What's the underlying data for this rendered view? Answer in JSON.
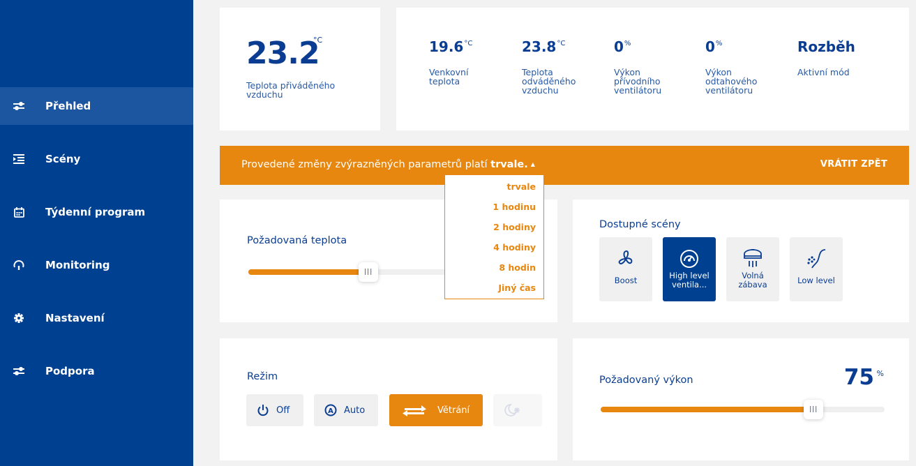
{
  "sidebar": {
    "items": [
      {
        "label": "Přehled",
        "icon": "sliders-icon",
        "active": true
      },
      {
        "label": "Scény",
        "icon": "list-indent-icon"
      },
      {
        "label": "Týdenní program",
        "icon": "calendar-icon"
      },
      {
        "label": "Monitoring",
        "icon": "gauge-icon"
      },
      {
        "label": "Nastavení",
        "icon": "gear-icon"
      },
      {
        "label": "Podpora",
        "icon": "sliders-icon"
      }
    ]
  },
  "supply_temp": {
    "value": "23.2",
    "unit": "°C",
    "label": "Teplota přiváděného vzduchu"
  },
  "stats": [
    {
      "value": "19.6",
      "unit": "°C",
      "label": "Venkovní teplota"
    },
    {
      "value": "23.8",
      "unit": "°C",
      "label": "Teplota odváděného vzduchu"
    },
    {
      "value": "0",
      "unit": "%",
      "label": "Výkon přívodního ventilátoru"
    },
    {
      "value": "0",
      "unit": "%",
      "label": "Výkon odtahového ventilátoru"
    },
    {
      "value": "Rozběh",
      "unit": "",
      "label": "Aktivní mód"
    }
  ],
  "banner": {
    "text": "Provedené změny zvýrazněných parametrů platí",
    "duration": "trvale.",
    "revert_label": "VRÁTIT ZPĚT",
    "color": "#e8870f"
  },
  "duration_dropdown": {
    "options": [
      "trvale",
      "1 hodinu",
      "2 hodiny",
      "4 hodiny",
      "8 hodin",
      "Jiný čas"
    ],
    "selected": "trvale"
  },
  "temperature": {
    "title": "Požadovaná teplota",
    "slider_fraction": 0.41
  },
  "scenes": {
    "title": "Dostupné scény",
    "items": [
      {
        "label": "Boost",
        "icon": "fan-icon",
        "active": false
      },
      {
        "label": "High level ventila...",
        "icon": "speedometer-icon",
        "active": true
      },
      {
        "label": "Volná zábava",
        "icon": "air-conditioner-icon",
        "active": false
      },
      {
        "label": "Low level",
        "icon": "breeze-icon",
        "active": false
      }
    ]
  },
  "mode": {
    "title": "Režim",
    "buttons": [
      {
        "label": "Off",
        "icon": "power-icon"
      },
      {
        "label": "Auto",
        "icon": "auto-icon"
      },
      {
        "label": "Větrání",
        "icon": "exchange-arrows-icon",
        "active": true
      },
      {
        "label": "",
        "icon": "night-mode-icon"
      }
    ]
  },
  "power": {
    "title": "Požadovaný výkon",
    "value": "75",
    "unit": "%",
    "slider_fraction": 0.75
  },
  "colors": {
    "primary": "#004090",
    "accent": "#e8870f",
    "sidebar_active": "#1d56a0"
  }
}
